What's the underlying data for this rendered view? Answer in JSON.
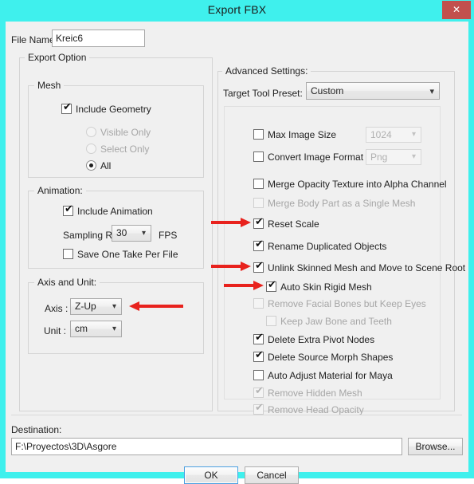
{
  "window": {
    "title": "Export FBX",
    "close_label": "✕",
    "accent_color": "#3ff0ed",
    "close_color": "#c2504d"
  },
  "file_name": {
    "label": "File Name:",
    "value": "Kreic6",
    "placeholder": ""
  },
  "export_option": {
    "title": "Export Option",
    "mesh": {
      "title": "Mesh",
      "include_geometry": {
        "label": "Include Geometry",
        "checked": true,
        "enabled": true
      },
      "options": [
        {
          "label": "Visible Only",
          "selected": false,
          "enabled": false
        },
        {
          "label": "Select Only",
          "selected": false,
          "enabled": false
        },
        {
          "label": "All",
          "selected": true,
          "enabled": true
        }
      ]
    },
    "animation": {
      "title": "Animation:",
      "include_animation": {
        "label": "Include Animation",
        "checked": true,
        "enabled": true
      },
      "sampling_rate": {
        "label": "Sampling Rate :",
        "value": "30",
        "unit": "FPS"
      },
      "save_one_take": {
        "label": "Save One Take Per File",
        "checked": false,
        "enabled": true
      }
    },
    "axis_and_unit": {
      "title": "Axis and Unit:",
      "axis": {
        "label": "Axis :",
        "value": "Z-Up"
      },
      "unit": {
        "label": "Unit :",
        "value": "cm"
      }
    }
  },
  "advanced_settings": {
    "title": "Advanced Settings:",
    "target_tool_preset": {
      "label": "Target Tool Preset:",
      "value": "Custom"
    },
    "items": [
      {
        "label": "Max Image Size",
        "checked": false,
        "enabled": true,
        "indent": 1,
        "combo": "1024",
        "combo_enabled": false
      },
      {
        "label": "Convert Image Format to",
        "checked": false,
        "enabled": true,
        "indent": 1,
        "combo": "Png",
        "combo_enabled": false
      },
      {
        "label": "Merge Opacity Texture into Alpha Channel",
        "checked": false,
        "enabled": true,
        "indent": 1
      },
      {
        "label": "Merge Body Part as a Single Mesh",
        "checked": false,
        "enabled": false,
        "indent": 1
      },
      {
        "label": "Reset Scale",
        "checked": true,
        "enabled": true,
        "indent": 1,
        "arrow": "right"
      },
      {
        "label": "Rename Duplicated Objects",
        "checked": true,
        "enabled": true,
        "indent": 1
      },
      {
        "label": "Unlink Skinned Mesh and Move to Scene Root",
        "checked": true,
        "enabled": true,
        "indent": 1,
        "arrow": "right"
      },
      {
        "label": "Auto Skin Rigid Mesh",
        "checked": true,
        "enabled": true,
        "indent": 2,
        "arrow": "right"
      },
      {
        "label": "Remove Facial Bones but Keep Eyes",
        "checked": false,
        "enabled": false,
        "indent": 1
      },
      {
        "label": "Keep Jaw Bone and Teeth",
        "checked": false,
        "enabled": false,
        "indent": 2
      },
      {
        "label": "Delete Extra Pivot Nodes",
        "checked": true,
        "enabled": true,
        "indent": 1
      },
      {
        "label": "Delete Source Morph Shapes",
        "checked": true,
        "enabled": true,
        "indent": 1
      },
      {
        "label": "Auto Adjust Material for Maya",
        "checked": false,
        "enabled": true,
        "indent": 1
      },
      {
        "label": "Remove Hidden Mesh",
        "checked": true,
        "enabled": false,
        "indent": 1
      },
      {
        "label": "Remove Head Opacity",
        "checked": true,
        "enabled": false,
        "indent": 1
      }
    ]
  },
  "destination": {
    "label": "Destination:",
    "value": "F:\\Proyectos\\3D\\Asgore",
    "browse_label": "Browse..."
  },
  "footer": {
    "ok_label": "OK",
    "cancel_label": "Cancel"
  }
}
